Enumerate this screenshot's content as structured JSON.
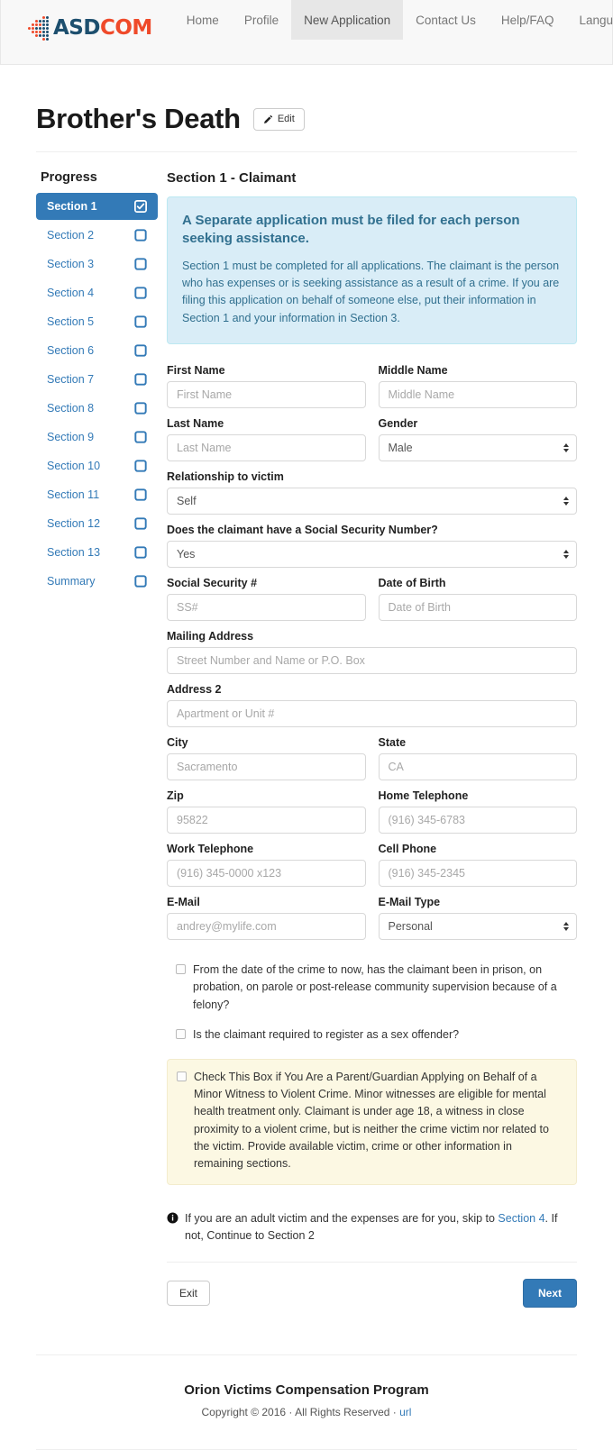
{
  "navbar": {
    "logo": {
      "part1": "ASD",
      "part2": "COM",
      "alt": "ASDCOM"
    },
    "items": [
      {
        "label": "Home",
        "active": false
      },
      {
        "label": "Profile",
        "active": false
      },
      {
        "label": "New Application",
        "active": true
      },
      {
        "label": "Contact Us",
        "active": false
      },
      {
        "label": "Help/FAQ",
        "active": false
      },
      {
        "label": "Language",
        "active": false,
        "caret": true
      }
    ]
  },
  "page": {
    "title": "Brother's Death",
    "edit_label": "Edit"
  },
  "sidebar": {
    "heading": "Progress",
    "items": [
      {
        "label": "Section 1",
        "active": true,
        "icon": "check-square-icon"
      },
      {
        "label": "Section 2",
        "active": false,
        "icon": "empty-square-icon"
      },
      {
        "label": "Section 3",
        "active": false,
        "icon": "empty-square-icon"
      },
      {
        "label": "Section 4",
        "active": false,
        "icon": "empty-square-icon"
      },
      {
        "label": "Section 5",
        "active": false,
        "icon": "empty-square-icon"
      },
      {
        "label": "Section 6",
        "active": false,
        "icon": "empty-square-icon"
      },
      {
        "label": "Section 7",
        "active": false,
        "icon": "empty-square-icon"
      },
      {
        "label": "Section 8",
        "active": false,
        "icon": "empty-square-icon"
      },
      {
        "label": "Section 9",
        "active": false,
        "icon": "empty-square-icon"
      },
      {
        "label": "Section 10",
        "active": false,
        "icon": "empty-square-icon"
      },
      {
        "label": "Section 11",
        "active": false,
        "icon": "empty-square-icon"
      },
      {
        "label": "Section 12",
        "active": false,
        "icon": "empty-square-icon"
      },
      {
        "label": "Section 13",
        "active": false,
        "icon": "empty-square-icon"
      },
      {
        "label": "Summary",
        "active": false,
        "icon": "empty-square-icon"
      }
    ]
  },
  "main": {
    "section_title": "Section 1 - Claimant",
    "alert": {
      "title": "A Separate application must be filed for each person seeking assistance.",
      "body": "Section 1 must be completed for all applications. The claimant is the person who has expenses or is seeking assistance as a result of a crime. If you are filing this application on behalf of someone else, put their information in Section 1 and your information in Section 3."
    },
    "fields": {
      "first_name": {
        "label": "First Name",
        "placeholder": "First Name",
        "value": ""
      },
      "middle_name": {
        "label": "Middle Name",
        "placeholder": "Middle Name",
        "value": ""
      },
      "last_name": {
        "label": "Last Name",
        "placeholder": "Last Name",
        "value": ""
      },
      "gender": {
        "label": "Gender",
        "value": "Male"
      },
      "relationship": {
        "label": "Relationship to victim",
        "value": "Self"
      },
      "has_ssn": {
        "label": "Does the claimant have a Social Security Number?",
        "value": "Yes"
      },
      "ssn": {
        "label": "Social Security #",
        "placeholder": "SS#",
        "value": ""
      },
      "dob": {
        "label": "Date of Birth",
        "placeholder": "Date of Birth",
        "value": ""
      },
      "mailing_address": {
        "label": "Mailing Address",
        "placeholder": "Street Number and Name or P.O. Box",
        "value": ""
      },
      "address2": {
        "label": "Address 2",
        "placeholder": "Apartment or Unit #",
        "value": ""
      },
      "city": {
        "label": "City",
        "placeholder": "Sacramento",
        "value": ""
      },
      "state": {
        "label": "State",
        "placeholder": "CA",
        "value": ""
      },
      "zip": {
        "label": "Zip",
        "placeholder": "95822",
        "value": ""
      },
      "home_phone": {
        "label": "Home Telephone",
        "placeholder": "(916) 345-6783",
        "value": ""
      },
      "work_phone": {
        "label": "Work Telephone",
        "placeholder": "(916) 345-0000 x123",
        "value": ""
      },
      "cell_phone": {
        "label": "Cell Phone",
        "placeholder": "(916) 345-2345",
        "value": ""
      },
      "email": {
        "label": "E-Mail",
        "placeholder": "andrey@mylife.com",
        "value": ""
      },
      "email_type": {
        "label": "E-Mail Type",
        "value": "Personal"
      }
    },
    "checkboxes": [
      {
        "text": "From the date of the crime to now, has the claimant been in prison, on probation, on parole or post-release community supervision because of a felony?",
        "checked": false
      },
      {
        "text": "Is the claimant required to register as a sex offender?",
        "checked": false
      }
    ],
    "warning_checkbox": {
      "text": "Check This Box if You Are a Parent/Guardian Applying on Behalf of a Minor Witness to Violent Crime. Minor witnesses are eligible for mental health treatment only. Claimant is under age 18, a witness in close proximity to a violent crime, but is neither the crime victim nor related to the victim. Provide available victim, crime or other information in remaining sections.",
      "checked": false
    },
    "note": {
      "before_link": "If you are an adult victim and the expenses are for you, skip to ",
      "link": "Section 4",
      "after_link": ". If not, Continue to Section 2"
    },
    "buttons": {
      "exit": "Exit",
      "next": "Next"
    }
  },
  "footer": {
    "title": "Orion Victims Compensation Program",
    "copyright": "Copyright © 2016 · All Rights Reserved · ",
    "url_label": "url"
  },
  "colors": {
    "primary": "#337ab7",
    "alert_bg": "#d9edf7",
    "alert_border": "#bce8f1",
    "alert_text": "#31708f",
    "warning_bg": "#fcf8e3",
    "navbar_bg": "#f8f8f8",
    "logo_dark": "#1d4f6e",
    "logo_orange": "#ef4a2a"
  }
}
